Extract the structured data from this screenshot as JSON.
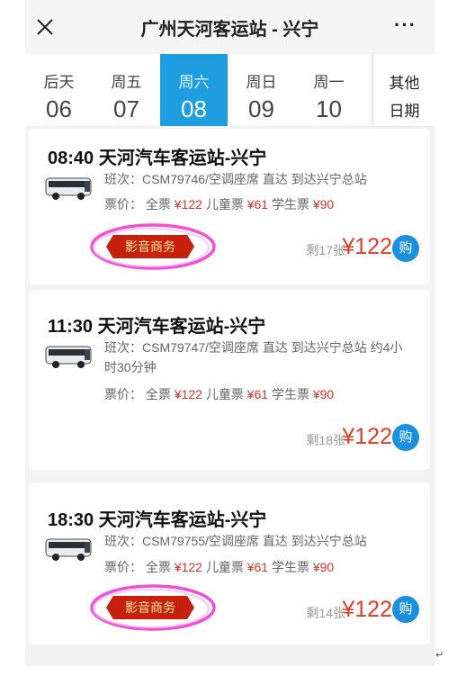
{
  "header": {
    "title": "广州天河客运站 - 兴宁",
    "close_icon": "close-icon",
    "more_label": "···"
  },
  "dates": [
    {
      "dow": "后天",
      "day": "06",
      "active": false
    },
    {
      "dow": "周五",
      "day": "07",
      "active": false
    },
    {
      "dow": "周六",
      "day": "08",
      "active": true
    },
    {
      "dow": "周日",
      "day": "09",
      "active": false
    },
    {
      "dow": "周一",
      "day": "10",
      "active": false
    }
  ],
  "other_dates": {
    "line1": "其他",
    "line2": "日期"
  },
  "trips": [
    {
      "time": "08:40",
      "route": "天河汽车客运站-兴宁",
      "info": "班次：CSM79746/空调座席 直达 到达兴宁总站",
      "price_label": "票价：",
      "full_label": "全票",
      "full_price": "¥122",
      "child_label": "儿童票",
      "child_price": "¥61",
      "student_label": "学生票",
      "student_price": "¥90",
      "badge": "影音商务",
      "remaining": "剩17张",
      "price": "¥122",
      "buy": "购"
    },
    {
      "time": "11:30",
      "route": "天河汽车客运站-兴宁",
      "info": "班次：CSM79747/空调座席 直达 到达兴宁总站 约4小时30分钟",
      "price_label": "票价：",
      "full_label": "全票",
      "full_price": "¥122",
      "child_label": "儿童票",
      "child_price": "¥61",
      "student_label": "学生票",
      "student_price": "¥90",
      "badge": "",
      "remaining": "剩18张",
      "price": "¥122",
      "buy": "购"
    },
    {
      "time": "18:30",
      "route": "天河汽车客运站-兴宁",
      "info": "班次：CSM79755/空调座席 直达 到达兴宁总站",
      "price_label": "票价：",
      "full_label": "全票",
      "full_price": "¥122",
      "child_label": "儿童票",
      "child_price": "¥61",
      "student_label": "学生票",
      "student_price": "¥90",
      "badge": "影音商务",
      "remaining": "剩14张",
      "price": "¥122",
      "buy": "购"
    }
  ],
  "colors": {
    "accent": "#1e9de0",
    "price_red": "#e03c26",
    "badge_red": "#c7200f",
    "highlight": "#f03cd0"
  },
  "corner_mark": "↵"
}
